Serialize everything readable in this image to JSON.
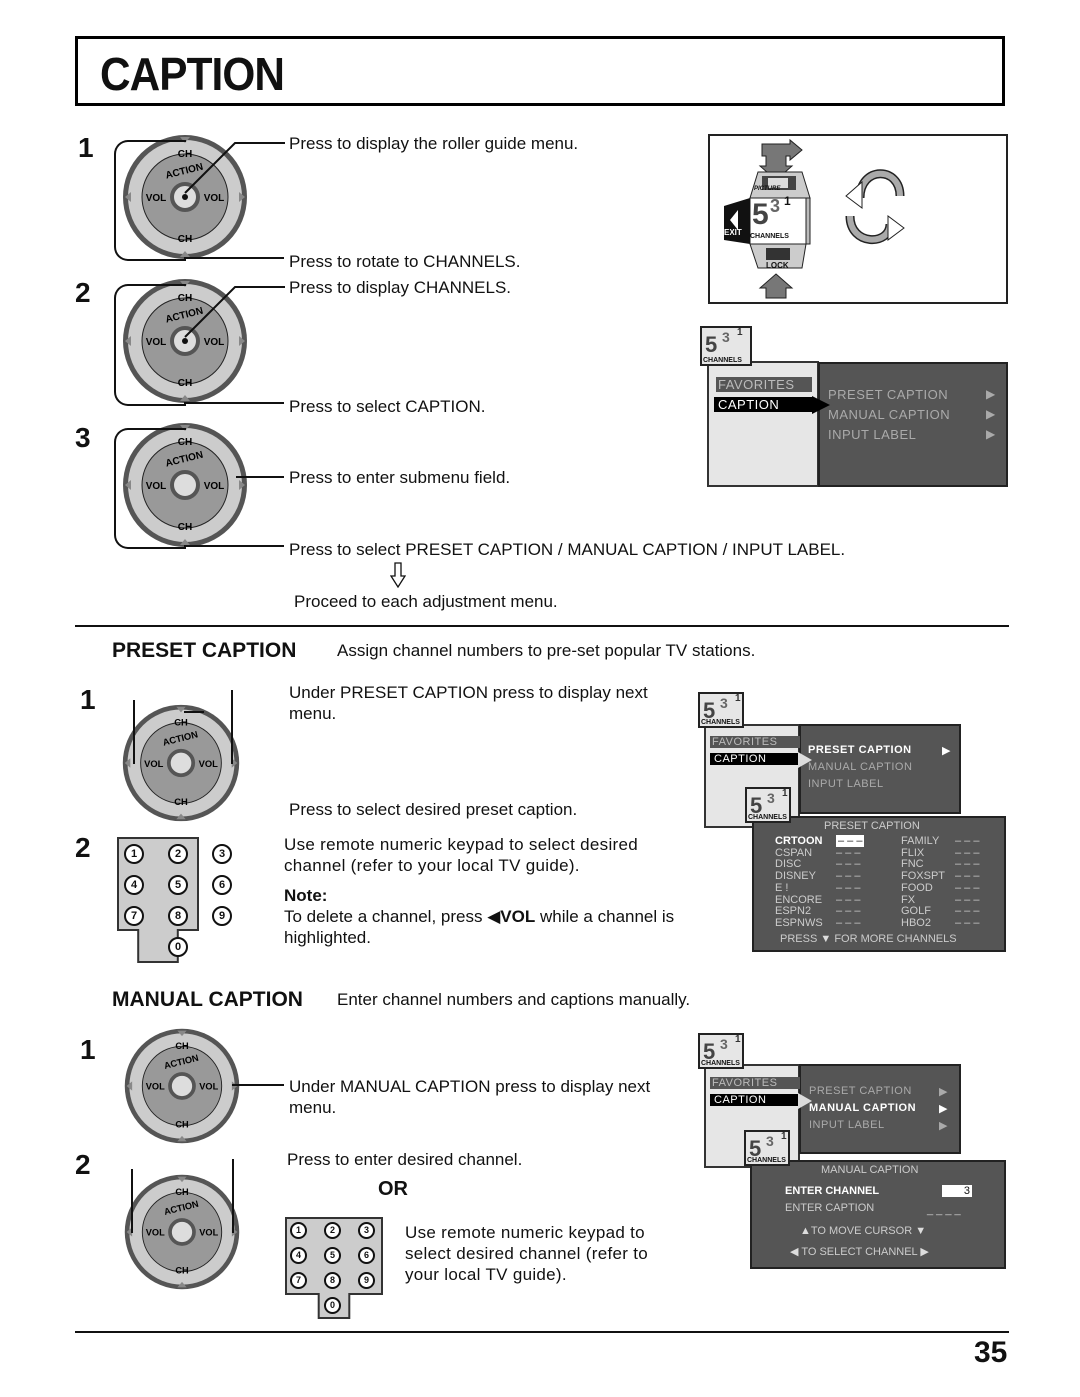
{
  "page": {
    "title": "CAPTION",
    "page_number": "35"
  },
  "intro": {
    "steps": [
      "1",
      "2",
      "3"
    ],
    "instructions": [
      "Press to display the roller guide menu.",
      "Press to rotate to CHANNELS.",
      "Press to display CHANNELS.",
      "Press to select CAPTION.",
      "Press to enter submenu field.",
      "Press to select PRESET CAPTION / MANUAL CAPTION / INPUT LABEL.",
      "Proceed to each adjustment menu."
    ],
    "dial": {
      "ch": "CH",
      "vol": "VOL",
      "action": "ACTION"
    },
    "roller": {
      "picture": "PICTURE",
      "channels": "CHANNELS",
      "lock": "LOCK",
      "exit": "EXIT",
      "digit_big": "5",
      "digit_mid": "3",
      "digit_sup": "1"
    },
    "menu": {
      "left_items": [
        "FAVORITES",
        "CAPTION"
      ],
      "right_items": [
        "PRESET CAPTION",
        "MANUAL CAPTION",
        "INPUT LABEL"
      ],
      "logo_label": "CHANNELS"
    }
  },
  "preset": {
    "heading": "PRESET CAPTION",
    "description": "Assign channel numbers to pre-set popular TV stations.",
    "steps": [
      "1",
      "2"
    ],
    "instructions": [
      "Under PRESET CAPTION press to display next menu.",
      "Press to select desired preset caption.",
      "Use remote numeric keypad to select desired channel (refer to your local TV guide)."
    ],
    "note_label": "Note:",
    "note_text_pre": "To delete a channel, press",
    "note_vol": "VOL",
    "note_text_post": "while a channel is highlighted.",
    "menu": {
      "left_items": [
        "FAVORITES",
        "CAPTION"
      ],
      "right_items": [
        "PRESET CAPTION",
        "MANUAL CAPTION",
        "INPUT LABEL"
      ],
      "selected": "PRESET CAPTION"
    },
    "submenu": {
      "title": "PRESET CAPTION",
      "left_column": [
        "CRTOON",
        "CSPAN",
        "DISC",
        "DISNEY",
        "E !",
        "ENCORE",
        "ESPN2",
        "ESPNWS"
      ],
      "right_column": [
        "FAMILY",
        "FLIX",
        "FNC",
        "FOXSPT",
        "FOOD",
        "FX",
        "GOLF",
        "HBO2"
      ],
      "placeholder": "– – –",
      "highlighted": "CRTOON",
      "footer_pre": "PRESS",
      "footer_post": "FOR MORE CHANNELS"
    }
  },
  "manual": {
    "heading": "MANUAL CAPTION",
    "description": "Enter channel numbers and captions manually.",
    "steps": [
      "1",
      "2"
    ],
    "instructions": [
      "Under MANUAL CAPTION press to display next menu.",
      "Press to enter desired channel.",
      "Use remote numeric keypad to select desired channel (refer to your local TV guide)."
    ],
    "or_label": "OR",
    "menu": {
      "left_items": [
        "FAVORITES",
        "CAPTION"
      ],
      "right_items": [
        "PRESET CAPTION",
        "MANUAL CAPTION",
        "INPUT LABEL"
      ],
      "selected": "MANUAL CAPTION"
    },
    "submenu": {
      "title": "MANUAL CAPTION",
      "enter_channel_label": "ENTER CHANNEL",
      "enter_channel_value": "3",
      "enter_caption_label": "ENTER CAPTION",
      "enter_caption_value": "_ _ _ _",
      "hint_cursor": "TO MOVE CURSOR",
      "hint_channel": "TO SELECT CHANNEL"
    }
  },
  "keypad": {
    "keys": [
      "1",
      "2",
      "3",
      "4",
      "5",
      "6",
      "7",
      "8",
      "9",
      "0"
    ]
  }
}
